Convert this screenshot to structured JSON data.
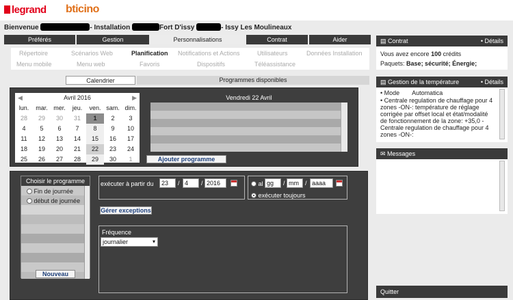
{
  "header": {
    "logo_legrand": "legrand",
    "logo_bticino": "bticino",
    "welcome_prefix": "Bienvenue",
    "welcome_mid": "- Installation",
    "welcome_place": "Fort D'issy",
    "welcome_suffix": "- Issy Les Moulineaux"
  },
  "tabs": [
    "Préférés",
    "Gestion",
    "Personnalisations",
    "Contrat",
    "Aider"
  ],
  "subnav": {
    "row1": [
      "Répertoire",
      "Scénarios Web",
      "Planification",
      "Notifications et Actions",
      "Utilisateurs",
      "Données Installation"
    ],
    "row2": [
      "Menu mobile",
      "Menu web",
      "Favoris",
      "Dispositifs",
      "Téléassistance"
    ]
  },
  "subtabs": {
    "calendar": "Calendrier",
    "programs": "Programmes disponibles"
  },
  "calendar": {
    "month": "Avril 2016",
    "weekdays": [
      "lun.",
      "mar.",
      "mer.",
      "jeu.",
      "ven.",
      "sam.",
      "dim."
    ],
    "weeks": [
      [
        "28",
        "29",
        "30",
        "31",
        "1",
        "2",
        "3"
      ],
      [
        "4",
        "5",
        "6",
        "7",
        "8",
        "9",
        "10"
      ],
      [
        "11",
        "12",
        "13",
        "14",
        "15",
        "16",
        "17"
      ],
      [
        "18",
        "19",
        "20",
        "21",
        "22",
        "23",
        "24"
      ],
      [
        "25",
        "26",
        "27",
        "28",
        "29",
        "30",
        "1"
      ]
    ]
  },
  "dayview": {
    "title": "Vendredi 22 Avril",
    "add_button": "Ajouter programme"
  },
  "program_chooser": {
    "title": "Choisir le programme",
    "option1": "Fin de journée",
    "option2": "début de journée",
    "new_button": "Nouveau"
  },
  "schedule": {
    "start_label": "exécuter à partir du",
    "start_day": "23",
    "start_month": "4",
    "start_year": "2016",
    "until_label": "al",
    "until_day_ph": "gg",
    "until_month_ph": "mm",
    "until_year_ph": "aaaa",
    "always_label": "exécuter toujours",
    "exceptions_button": "Gérer exceptions",
    "frequency_label": "Fréquence",
    "frequency_value": "journalier"
  },
  "contract": {
    "title": "Contrat",
    "details": "• Détails",
    "credits_prefix": "Vous avez encore",
    "credits_value": "100",
    "credits_suffix": "crédits",
    "packs_label": "Paquets:",
    "packs_value": "Base; sécurité; Énergie;"
  },
  "temperature": {
    "title": "Gestion de la température",
    "details": "• Détails",
    "mode_label": "• Mode",
    "mode_value": "Automatica",
    "body1": "• Centrale regulation de chauffage pour 4 zones -ON-: température de réglage corrigée par offset local et état/modalité de fonctionnement de la zone: +35,0 - Centrale regulation de chauffage pour 4 zones -ON-:"
  },
  "messages": {
    "title": "Messages"
  },
  "quit": {
    "label": "Quitter"
  }
}
